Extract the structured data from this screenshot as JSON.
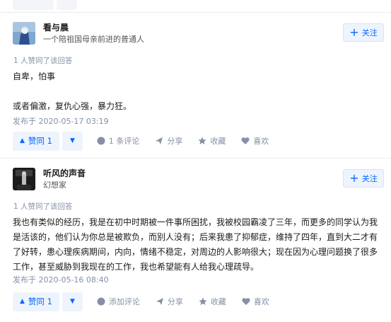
{
  "answers": [
    {
      "author": {
        "name": "看与晨",
        "bio": "一个陪祖国母亲前进的普通人"
      },
      "follow_label": "关注",
      "upvoted_note": "1 人赞同了该回答",
      "content": [
        "自卑，怕事",
        "",
        "或者偏激，复仇心强，暴力狂。"
      ],
      "time": "发布于 2020-05-17 03:19",
      "vote_label": "赞同 1",
      "actions": {
        "comment": "1 条评论",
        "share": "分享",
        "favorite": "收藏",
        "like": "喜欢"
      }
    },
    {
      "author": {
        "name": "听风的声音",
        "bio": "幻想家"
      },
      "follow_label": "关注",
      "upvoted_note": "1 人赞同了该回答",
      "content": [
        "我也有类似的经历，我是在初中时期被一件事所困扰，我被校园霸凌了三年，而更多的同学认为我是活该的，他们认为你总是被欺负，而别人没有；后来我患了抑郁症，维持了四年，直到大二才有了好转，患心理疾病期间，内向，情绪不稳定，对周边的人影响很大；现在因为心理问题换了很多工作，甚至威胁到我现在的工作，我也希望能有人给我心理疏导。"
      ],
      "time": "发布于 2020-05-16 08:40",
      "vote_label": "赞同 1",
      "actions": {
        "comment": "添加评论",
        "share": "分享",
        "favorite": "收藏",
        "like": "喜欢"
      }
    }
  ],
  "colors": {
    "accent": "#0066ff",
    "muted": "#8590a6",
    "vote_bg": "#eef4fd"
  }
}
